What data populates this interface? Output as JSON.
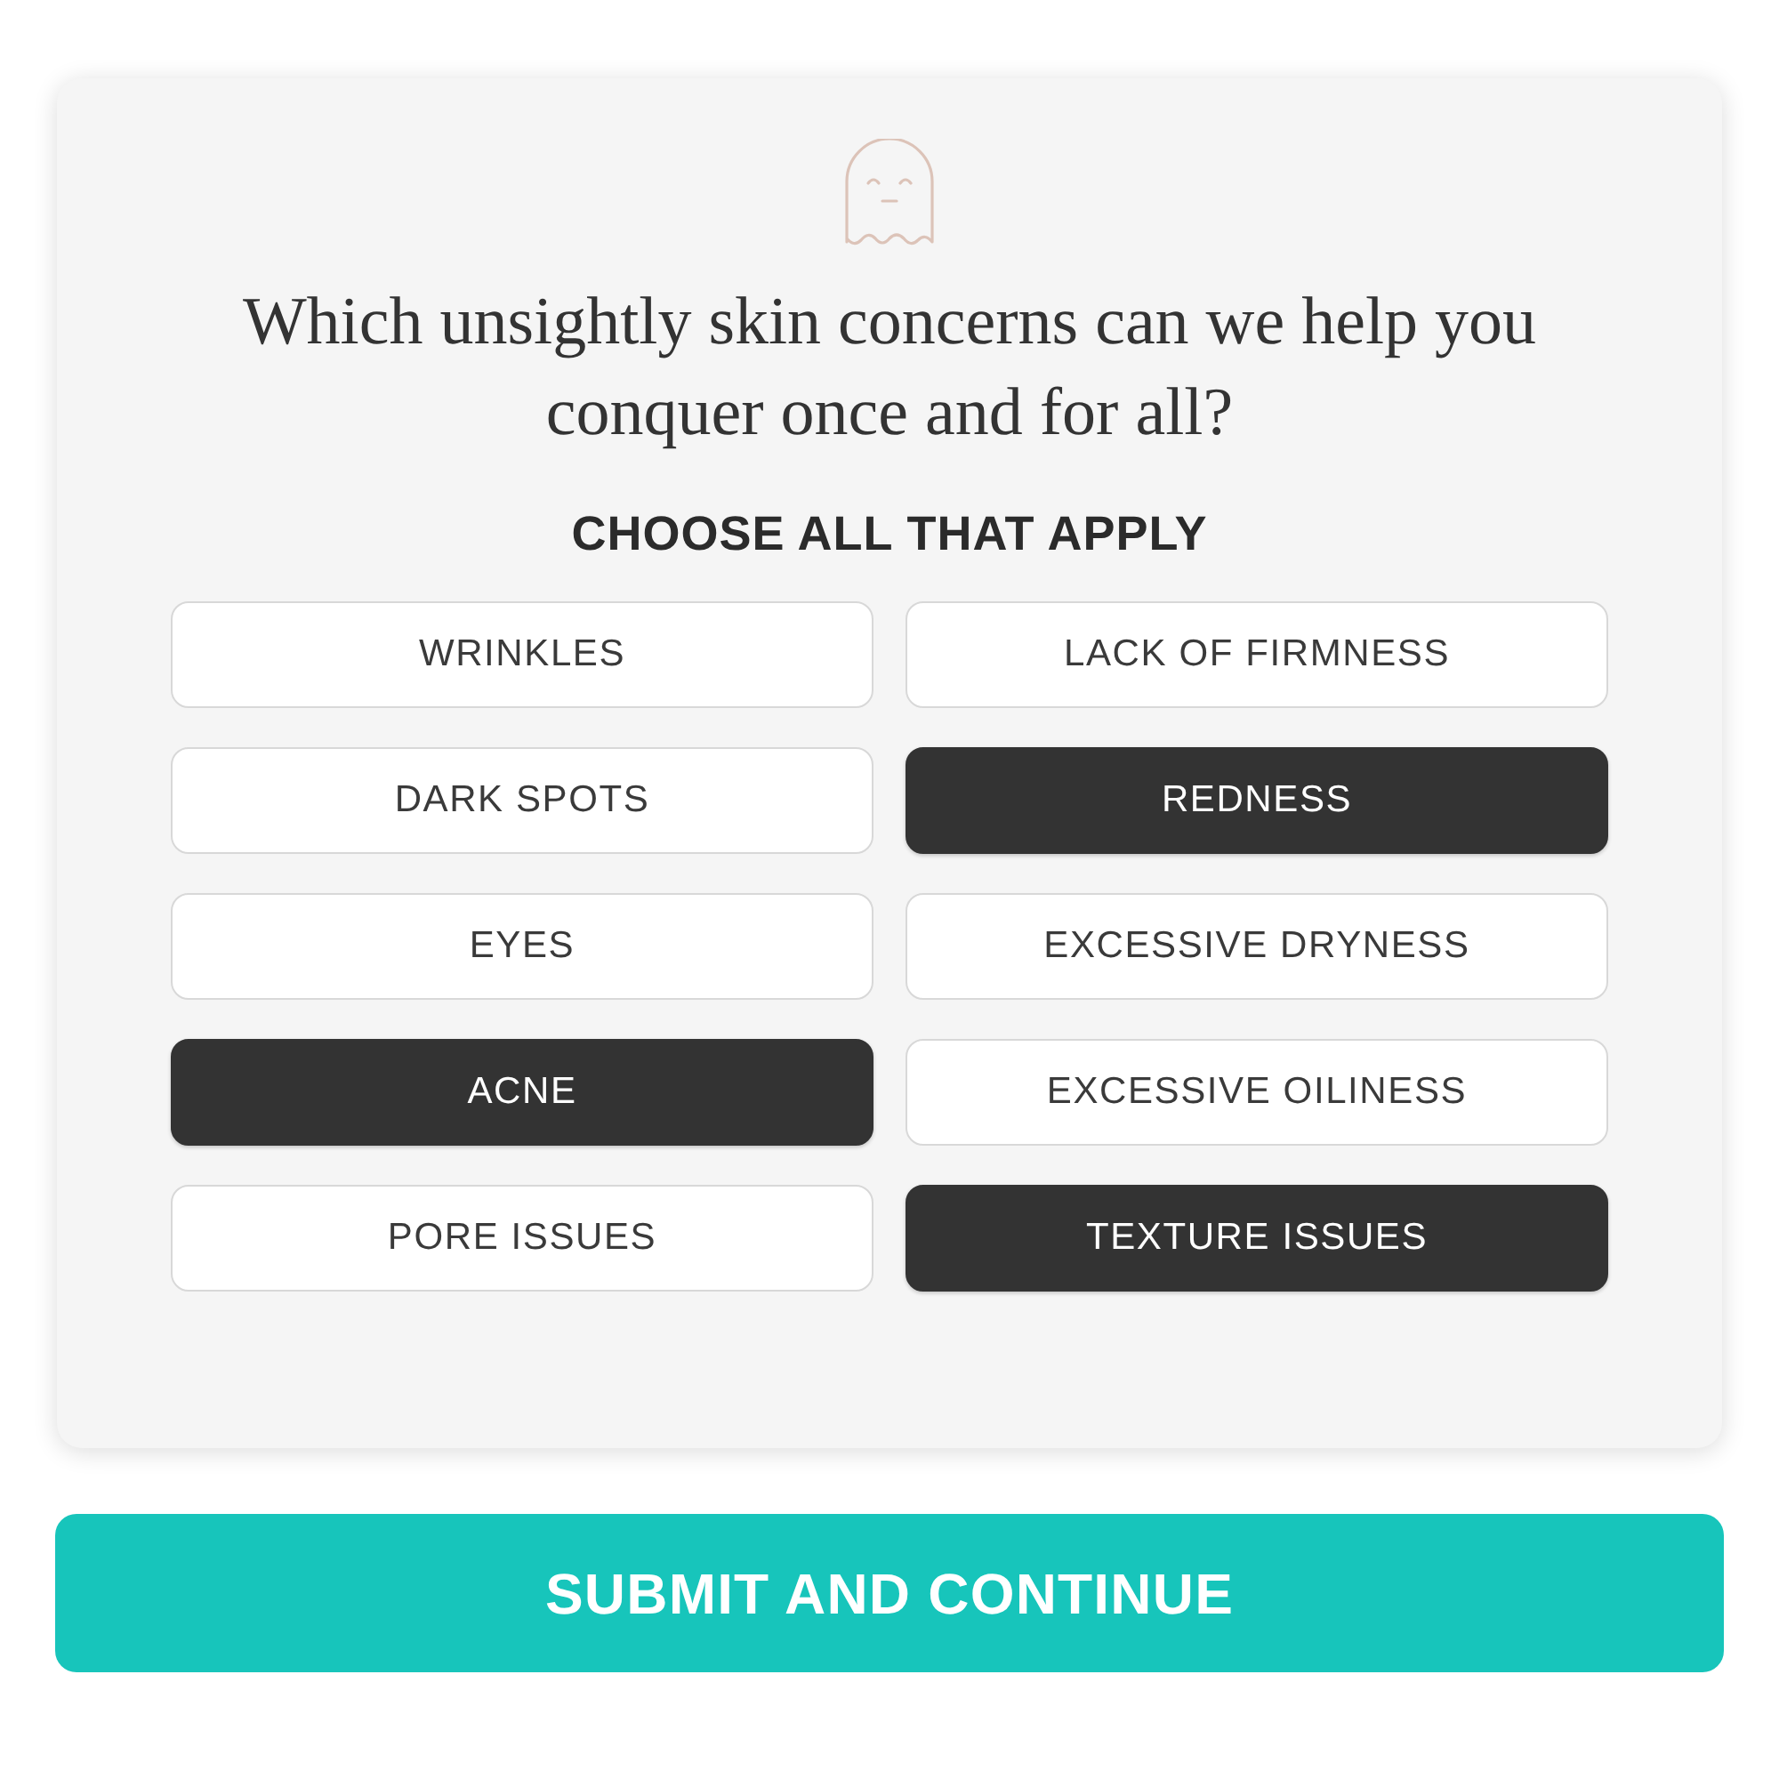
{
  "question": "Which unsightly skin concerns can we help you conquer once and for all?",
  "instruction": "CHOOSE ALL THAT APPLY",
  "options": [
    {
      "label": "WRINKLES",
      "selected": false
    },
    {
      "label": "LACK OF FIRMNESS",
      "selected": false
    },
    {
      "label": "DARK SPOTS",
      "selected": false
    },
    {
      "label": "REDNESS",
      "selected": true
    },
    {
      "label": "EYES",
      "selected": false
    },
    {
      "label": "EXCESSIVE DRYNESS",
      "selected": false
    },
    {
      "label": "ACNE",
      "selected": true
    },
    {
      "label": "EXCESSIVE OILINESS",
      "selected": false
    },
    {
      "label": "PORE ISSUES",
      "selected": false
    },
    {
      "label": "TEXTURE ISSUES",
      "selected": true
    }
  ],
  "submit_button": "SUBMIT AND CONTINUE"
}
